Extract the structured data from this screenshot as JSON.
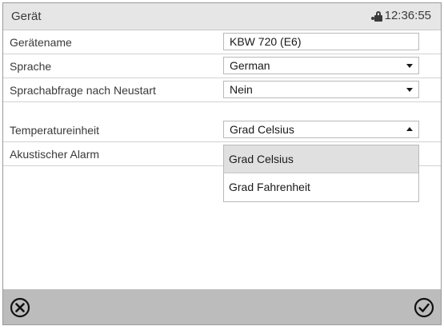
{
  "header": {
    "title": "Gerät",
    "time": "12:36:55",
    "lock_icon": "lock-icon"
  },
  "rows": [
    {
      "label": "Gerätename",
      "value": "KBW 720 (E6)",
      "type": "text"
    },
    {
      "label": "Sprache",
      "value": "German",
      "type": "select"
    },
    {
      "label": "Sprachabfrage nach Neustart",
      "value": "Nein",
      "type": "select"
    },
    {
      "label": "Temperatureinheit",
      "value": "Grad Celsius",
      "type": "select-open"
    },
    {
      "label": "Akustischer Alarm"
    }
  ],
  "dropdown": {
    "options": [
      "Grad Celsius",
      "Grad Fahrenheit"
    ],
    "selected_index": 0
  },
  "footer": {
    "cancel_icon": "cancel-icon",
    "confirm_icon": "confirm-icon"
  }
}
